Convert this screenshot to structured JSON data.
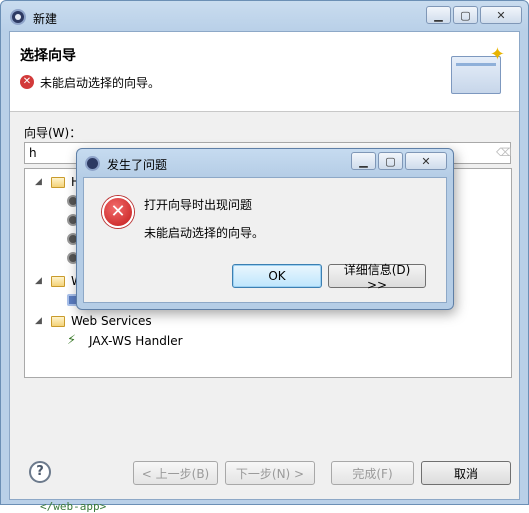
{
  "window": {
    "title": "新建",
    "minimize": "▁",
    "maximize": "▢",
    "close": "✕"
  },
  "banner": {
    "title": "选择向导",
    "message": "未能启动选择的向导。",
    "error_glyph": "✕"
  },
  "filter": {
    "label": "向导(W)：",
    "value": "h",
    "clear_glyph": "⌫"
  },
  "tree": {
    "rows": [
      {
        "label": "H",
        "kind": "folder",
        "expanded": true
      },
      {
        "label": "",
        "kind": "gear"
      },
      {
        "label": "",
        "kind": "gear"
      },
      {
        "label": "",
        "kind": "gear"
      },
      {
        "label": "",
        "kind": "gear"
      },
      {
        "label": "W",
        "kind": "folder",
        "expanded": true
      },
      {
        "label": "",
        "kind": "item"
      },
      {
        "label": "Web Services",
        "kind": "folder",
        "expanded": true
      },
      {
        "label": "JAX-WS Handler",
        "kind": "handler"
      }
    ],
    "expanded_glyph": "◢"
  },
  "buttons": {
    "help": "?",
    "back": "< 上一步(B)",
    "next": "下一步(N) >",
    "finish": "完成(F)",
    "cancel": "取消"
  },
  "background_peek": "</web-app>",
  "dialog": {
    "title": "发生了问题",
    "line1": "打开向导时出现问题",
    "line2": "未能启动选择的向导。",
    "ok": "OK",
    "details": "详细信息(D) >>",
    "error_glyph": "✕",
    "minimize": "▁",
    "maximize": "▢",
    "close": "✕"
  }
}
